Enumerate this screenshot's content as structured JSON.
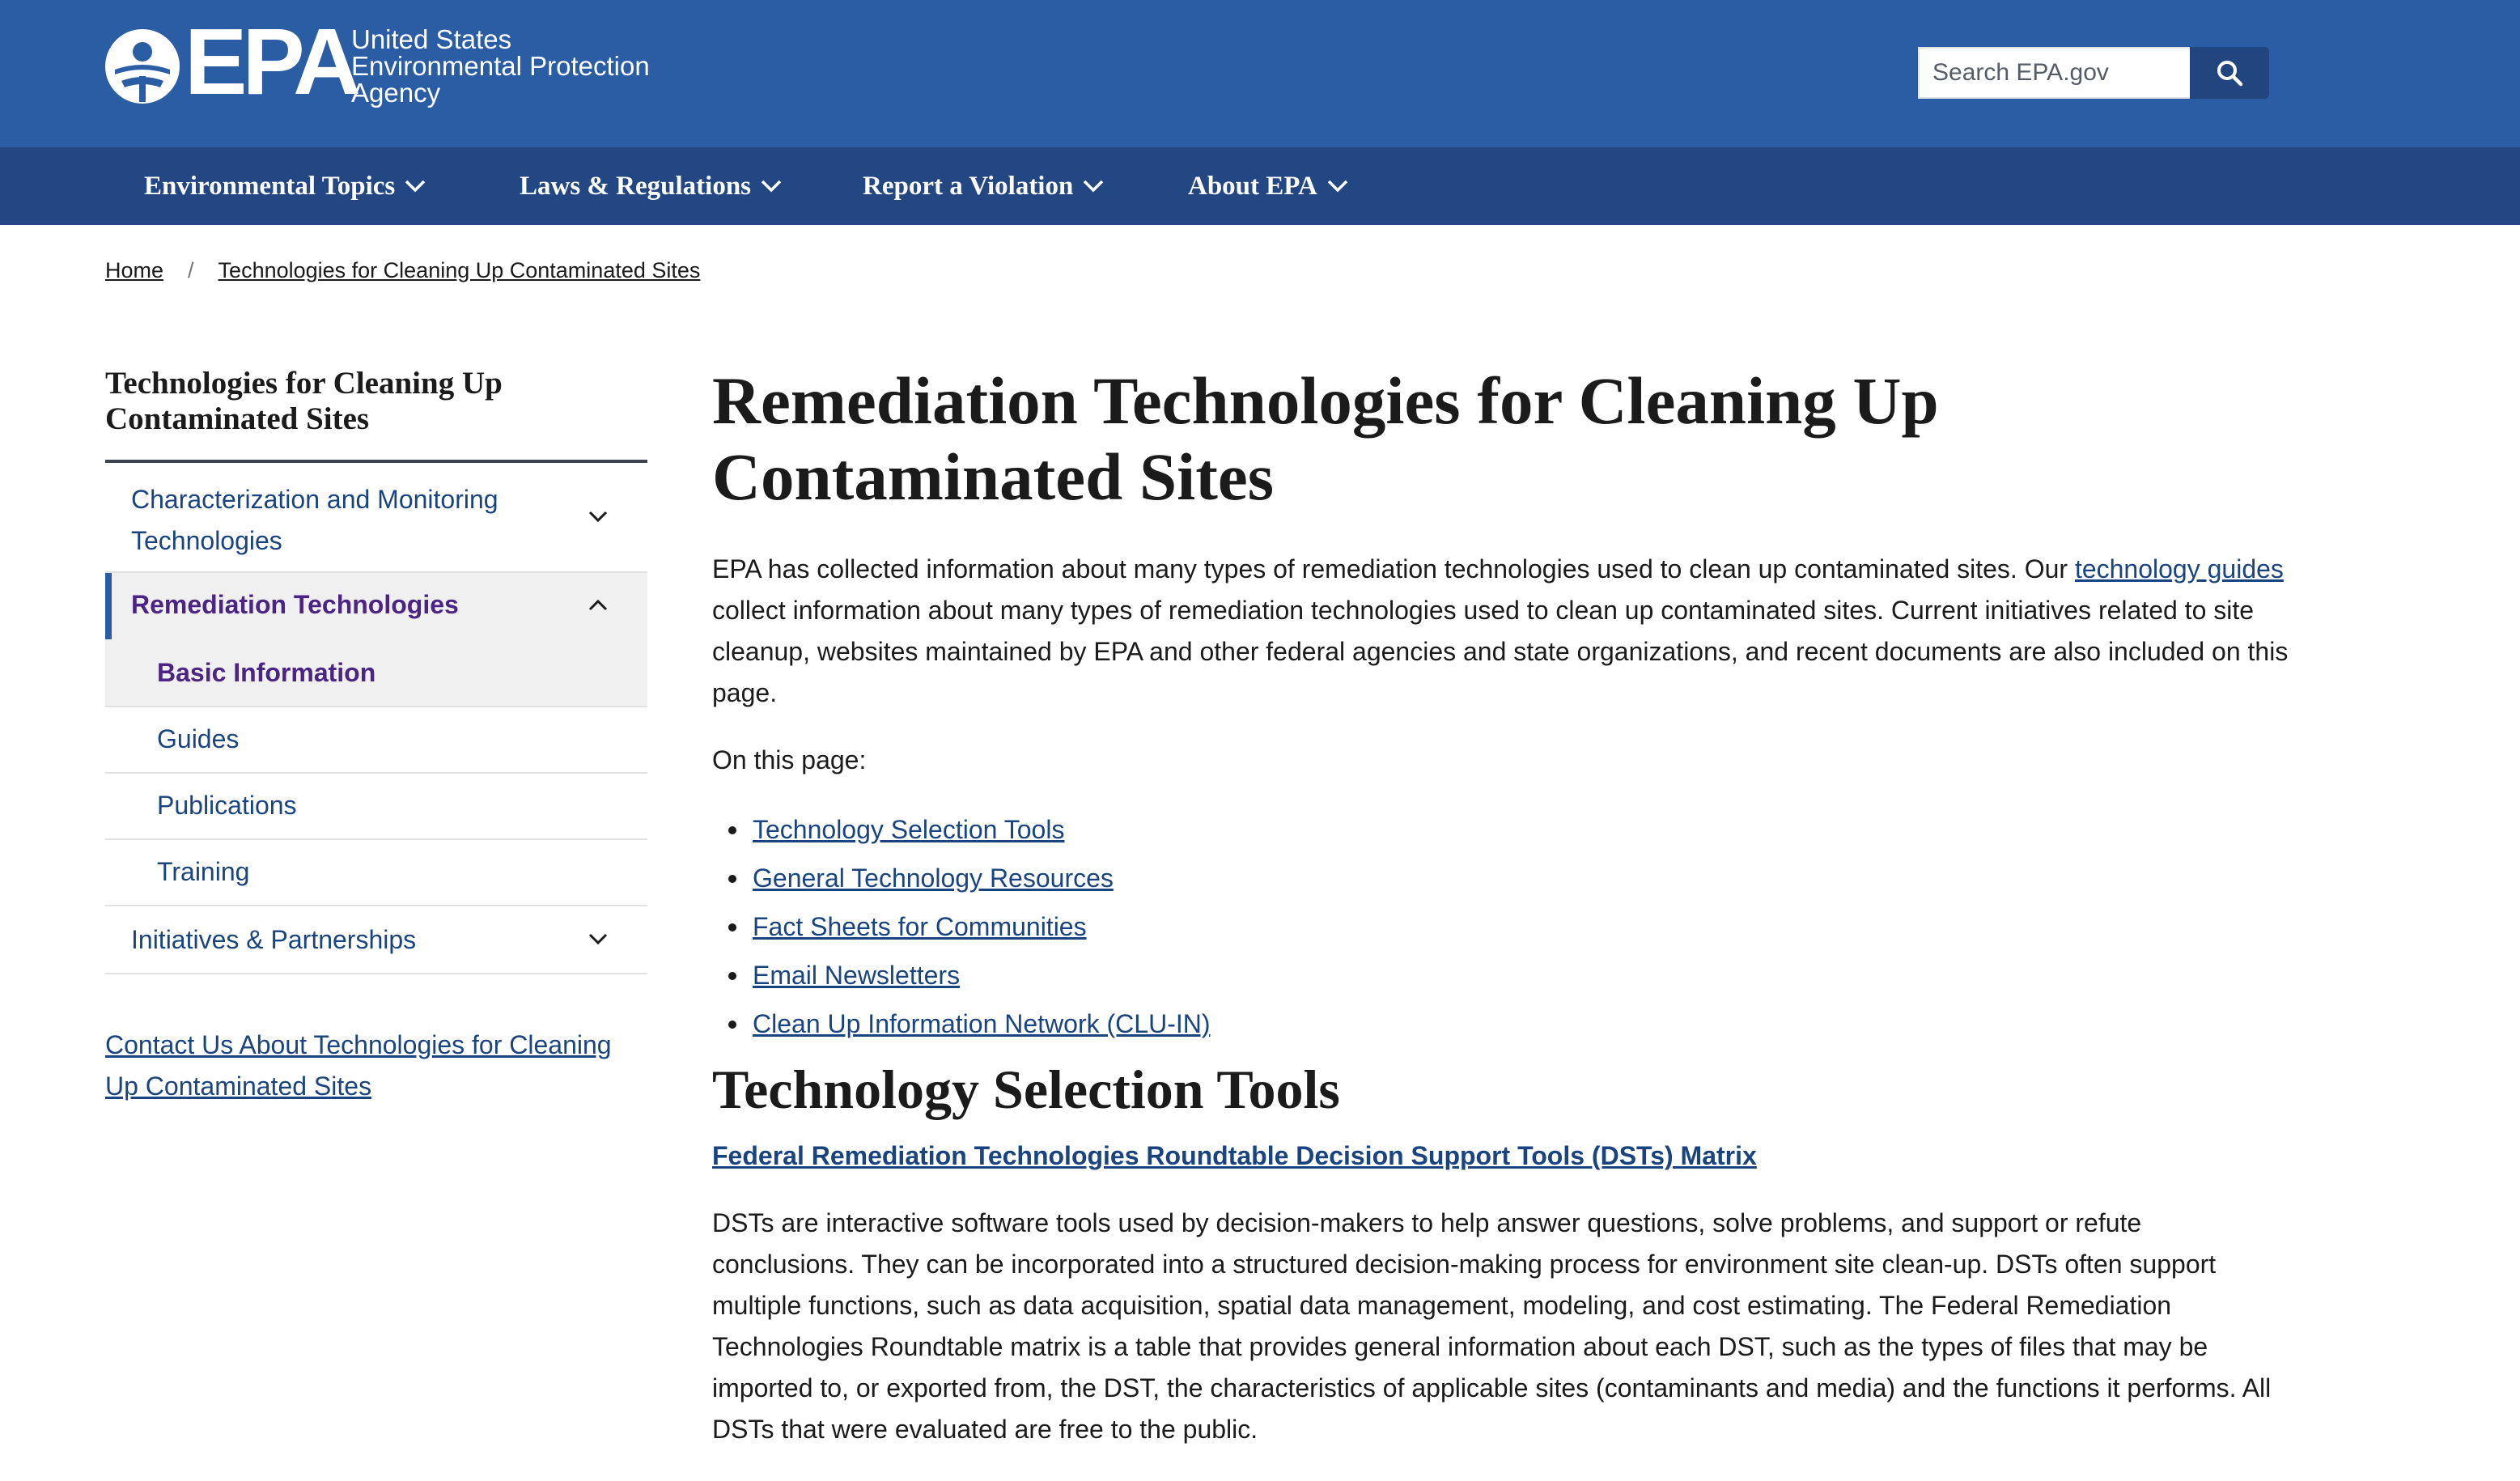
{
  "header": {
    "logo_text": "EPA",
    "agency_line1": "United States",
    "agency_line2": "Environmental Protection",
    "agency_line3": "Agency",
    "search_placeholder": "Search EPA.gov",
    "colors": {
      "header_bg": "#2a5da4",
      "nav_bg": "#234782",
      "link": "#1a4480",
      "visited": "#4a2584"
    }
  },
  "nav": {
    "items": [
      {
        "label": "Environmental Topics",
        "icon": "chevron-down-icon"
      },
      {
        "label": "Laws & Regulations",
        "icon": "chevron-down-icon"
      },
      {
        "label": "Report a Violation",
        "icon": "chevron-down-icon"
      },
      {
        "label": "About EPA",
        "icon": "chevron-down-icon"
      }
    ]
  },
  "breadcrumb": {
    "home": "Home",
    "separator": "/",
    "current": "Technologies for Cleaning Up Contaminated Sites"
  },
  "sidebar": {
    "title": "Technologies for Cleaning Up Contaminated Sites",
    "items": [
      {
        "label": "Characterization and Monitoring Technologies",
        "state": "collapsed"
      },
      {
        "label": "Remediation Technologies",
        "state": "expanded"
      },
      {
        "label": "Basic Information",
        "state": "current"
      },
      {
        "label": "Guides"
      },
      {
        "label": "Publications"
      },
      {
        "label": "Training"
      },
      {
        "label": "Initiatives & Partnerships",
        "state": "collapsed"
      }
    ],
    "contact": "Contact Us About Technologies for Cleaning Up Contaminated Sites"
  },
  "main": {
    "title": "Remediation Technologies for Cleaning Up Contaminated Sites",
    "intro_before": "EPA has collected information about many types of remediation technologies used to clean up contaminated sites. Our ",
    "intro_link": "technology guides",
    "intro_after": " collect information about many types of remediation technologies used to clean up contaminated sites. Current initiatives related to site cleanup, websites maintained by EPA and other federal agencies and state organizations, and recent documents are also included on this page.",
    "on_this_page": "On this page:",
    "toc": [
      "Technology Selection Tools",
      "General Technology Resources",
      "Fact Sheets for Communities",
      "Email Newsletters",
      "Clean Up Information Network (CLU-IN)"
    ],
    "section_title": "Technology Selection Tools",
    "dst_link": "Federal Remediation Technologies Roundtable Decision Support Tools (DSTs) Matrix",
    "dst_desc": "DSTs are interactive software tools used by decision-makers to help answer questions, solve problems, and support or refute conclusions. They can be incorporated into a structured decision-making process for environment site clean-up. DSTs often support multiple functions, such as data acquisition, spatial data management, modeling, and cost estimating. The Federal Remediation Technologies Roundtable matrix is a table that provides general information about each DST, such as the types of files that may be imported to, or exported from, the DST, the characteristics of applicable sites (contaminants and media) and the functions it performs. All DSTs that were evaluated are free to the public."
  }
}
